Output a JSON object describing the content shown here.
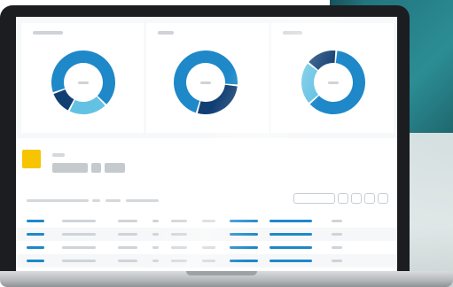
{
  "colors": {
    "donut_dark": "#123f73",
    "donut_main": "#1e88c9",
    "donut_light": "#63c2e3",
    "tile": "#f6c400",
    "bezel": "#1b1d20",
    "placeholder": "#cfd3d6"
  },
  "cards": [
    {
      "segments": [
        {
          "color": "#1e88c9",
          "value": 0.68
        },
        {
          "color": "#63c2e3",
          "value": 0.2
        },
        {
          "color": "#123f73",
          "value": 0.12
        }
      ]
    },
    {
      "segments": [
        {
          "color": "#1e88c9",
          "value": 0.72
        },
        {
          "color": "#123f73",
          "value": 0.28
        }
      ]
    },
    {
      "segments": [
        {
          "color": "#1e88c9",
          "value": 0.62
        },
        {
          "color": "#63c2e3",
          "value": 0.22
        },
        {
          "color": "#123f73",
          "value": 0.16
        }
      ]
    }
  ],
  "table": {
    "rows": 5
  }
}
